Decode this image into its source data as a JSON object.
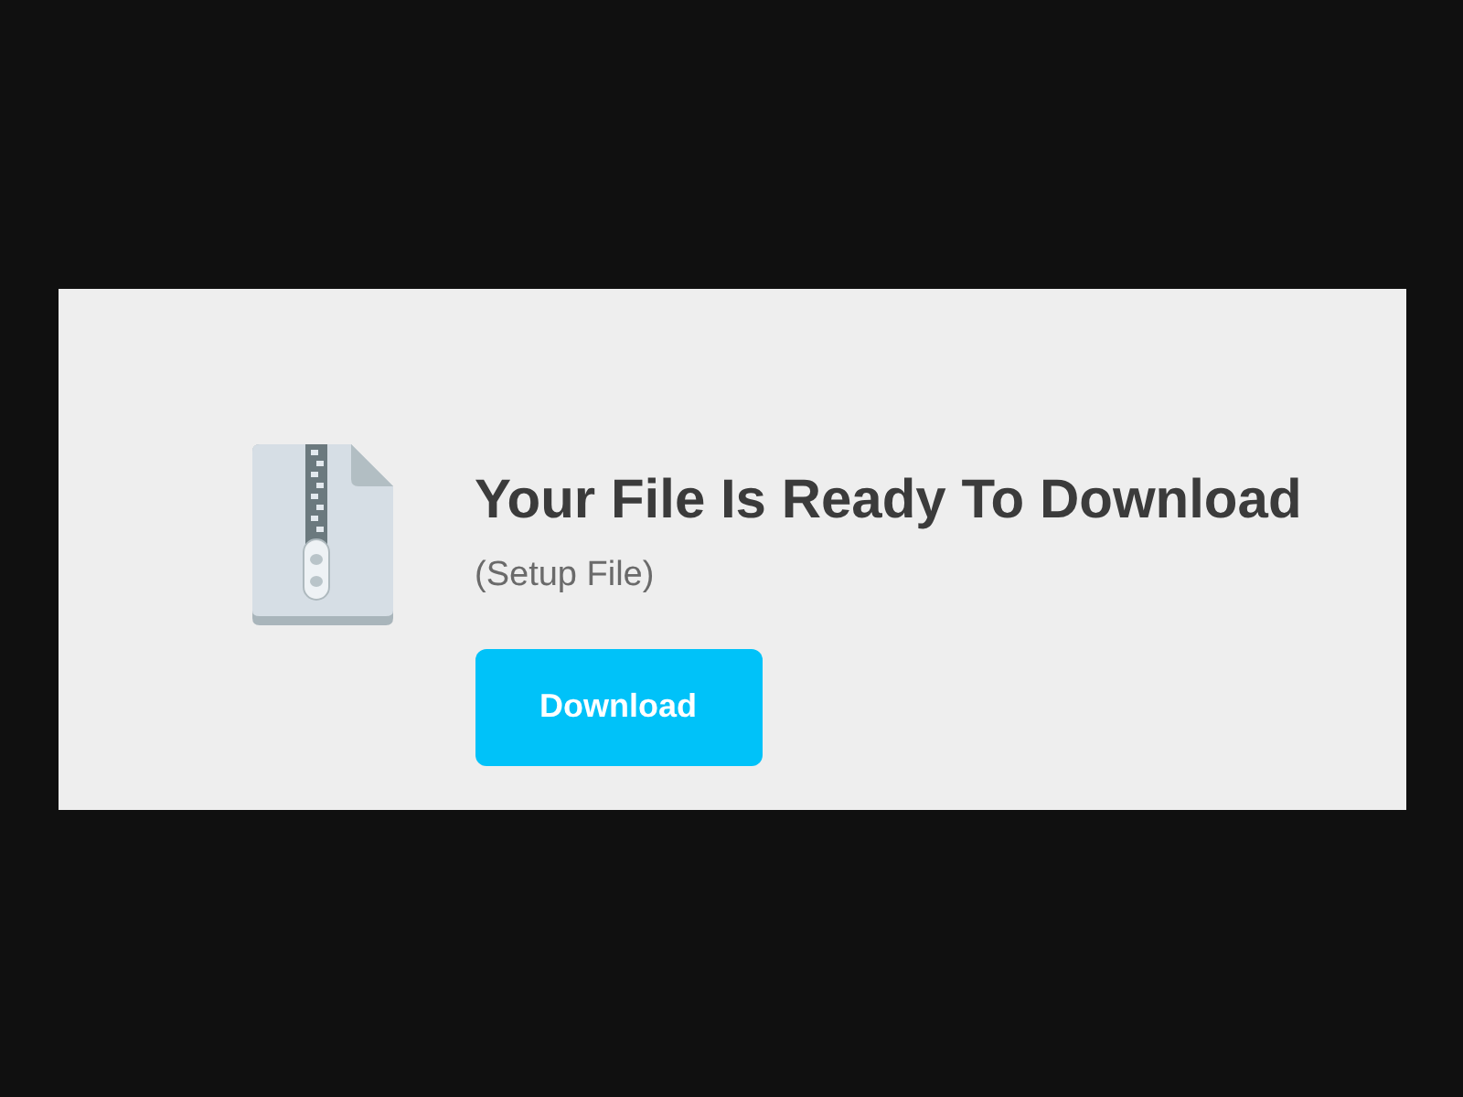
{
  "card": {
    "title": "Your File Is Ready To Download",
    "subtitle": "(Setup File)",
    "button": "Download"
  }
}
